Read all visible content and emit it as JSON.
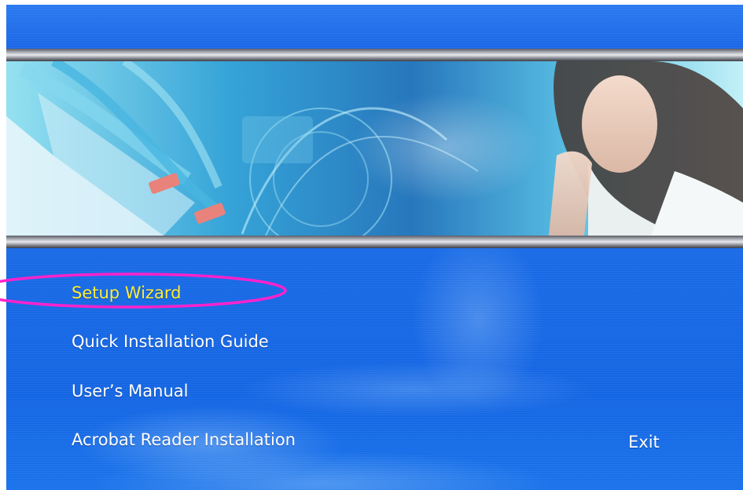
{
  "menu": {
    "items": [
      {
        "label": "Setup Wizard",
        "active": true
      },
      {
        "label": "Quick Installation Guide",
        "active": false
      },
      {
        "label": "User’s Manual",
        "active": false
      },
      {
        "label": "Acrobat Reader Installation",
        "active": false
      }
    ],
    "exit_label": "Exit"
  },
  "colors": {
    "background_blue": "#1763e4",
    "active_text": "#ffee33",
    "text": "#ffffff",
    "annotation_ellipse": "#ff22cc"
  }
}
